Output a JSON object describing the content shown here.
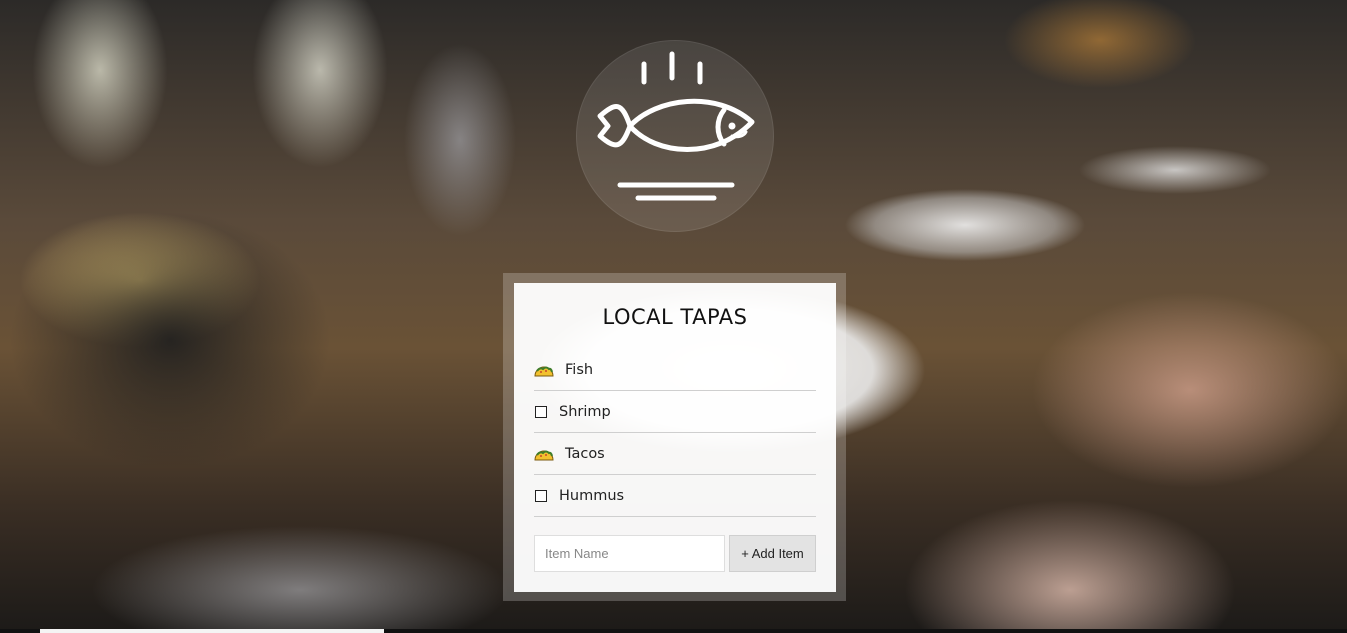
{
  "app": {
    "title": "LOCAL TAPAS"
  },
  "logo": {
    "icon": "steaming-fish-dish-icon",
    "color": "#ffffff"
  },
  "list": {
    "items": [
      {
        "label": "Fish",
        "icon": "taco-icon",
        "done": true
      },
      {
        "label": "Shrimp",
        "icon": "checkbox-icon",
        "done": false
      },
      {
        "label": "Tacos",
        "icon": "taco-icon",
        "done": true
      },
      {
        "label": "Hummus",
        "icon": "checkbox-icon",
        "done": false
      }
    ]
  },
  "form": {
    "input_placeholder": "Item Name",
    "input_value": "",
    "add_label": "+ Add Item"
  },
  "colors": {
    "card": "#ffffff",
    "divider": "#cfcfcf",
    "button": "#e3e3e3",
    "taco_shell": "#f2c12e",
    "taco_filling": "#3f7d2a"
  }
}
